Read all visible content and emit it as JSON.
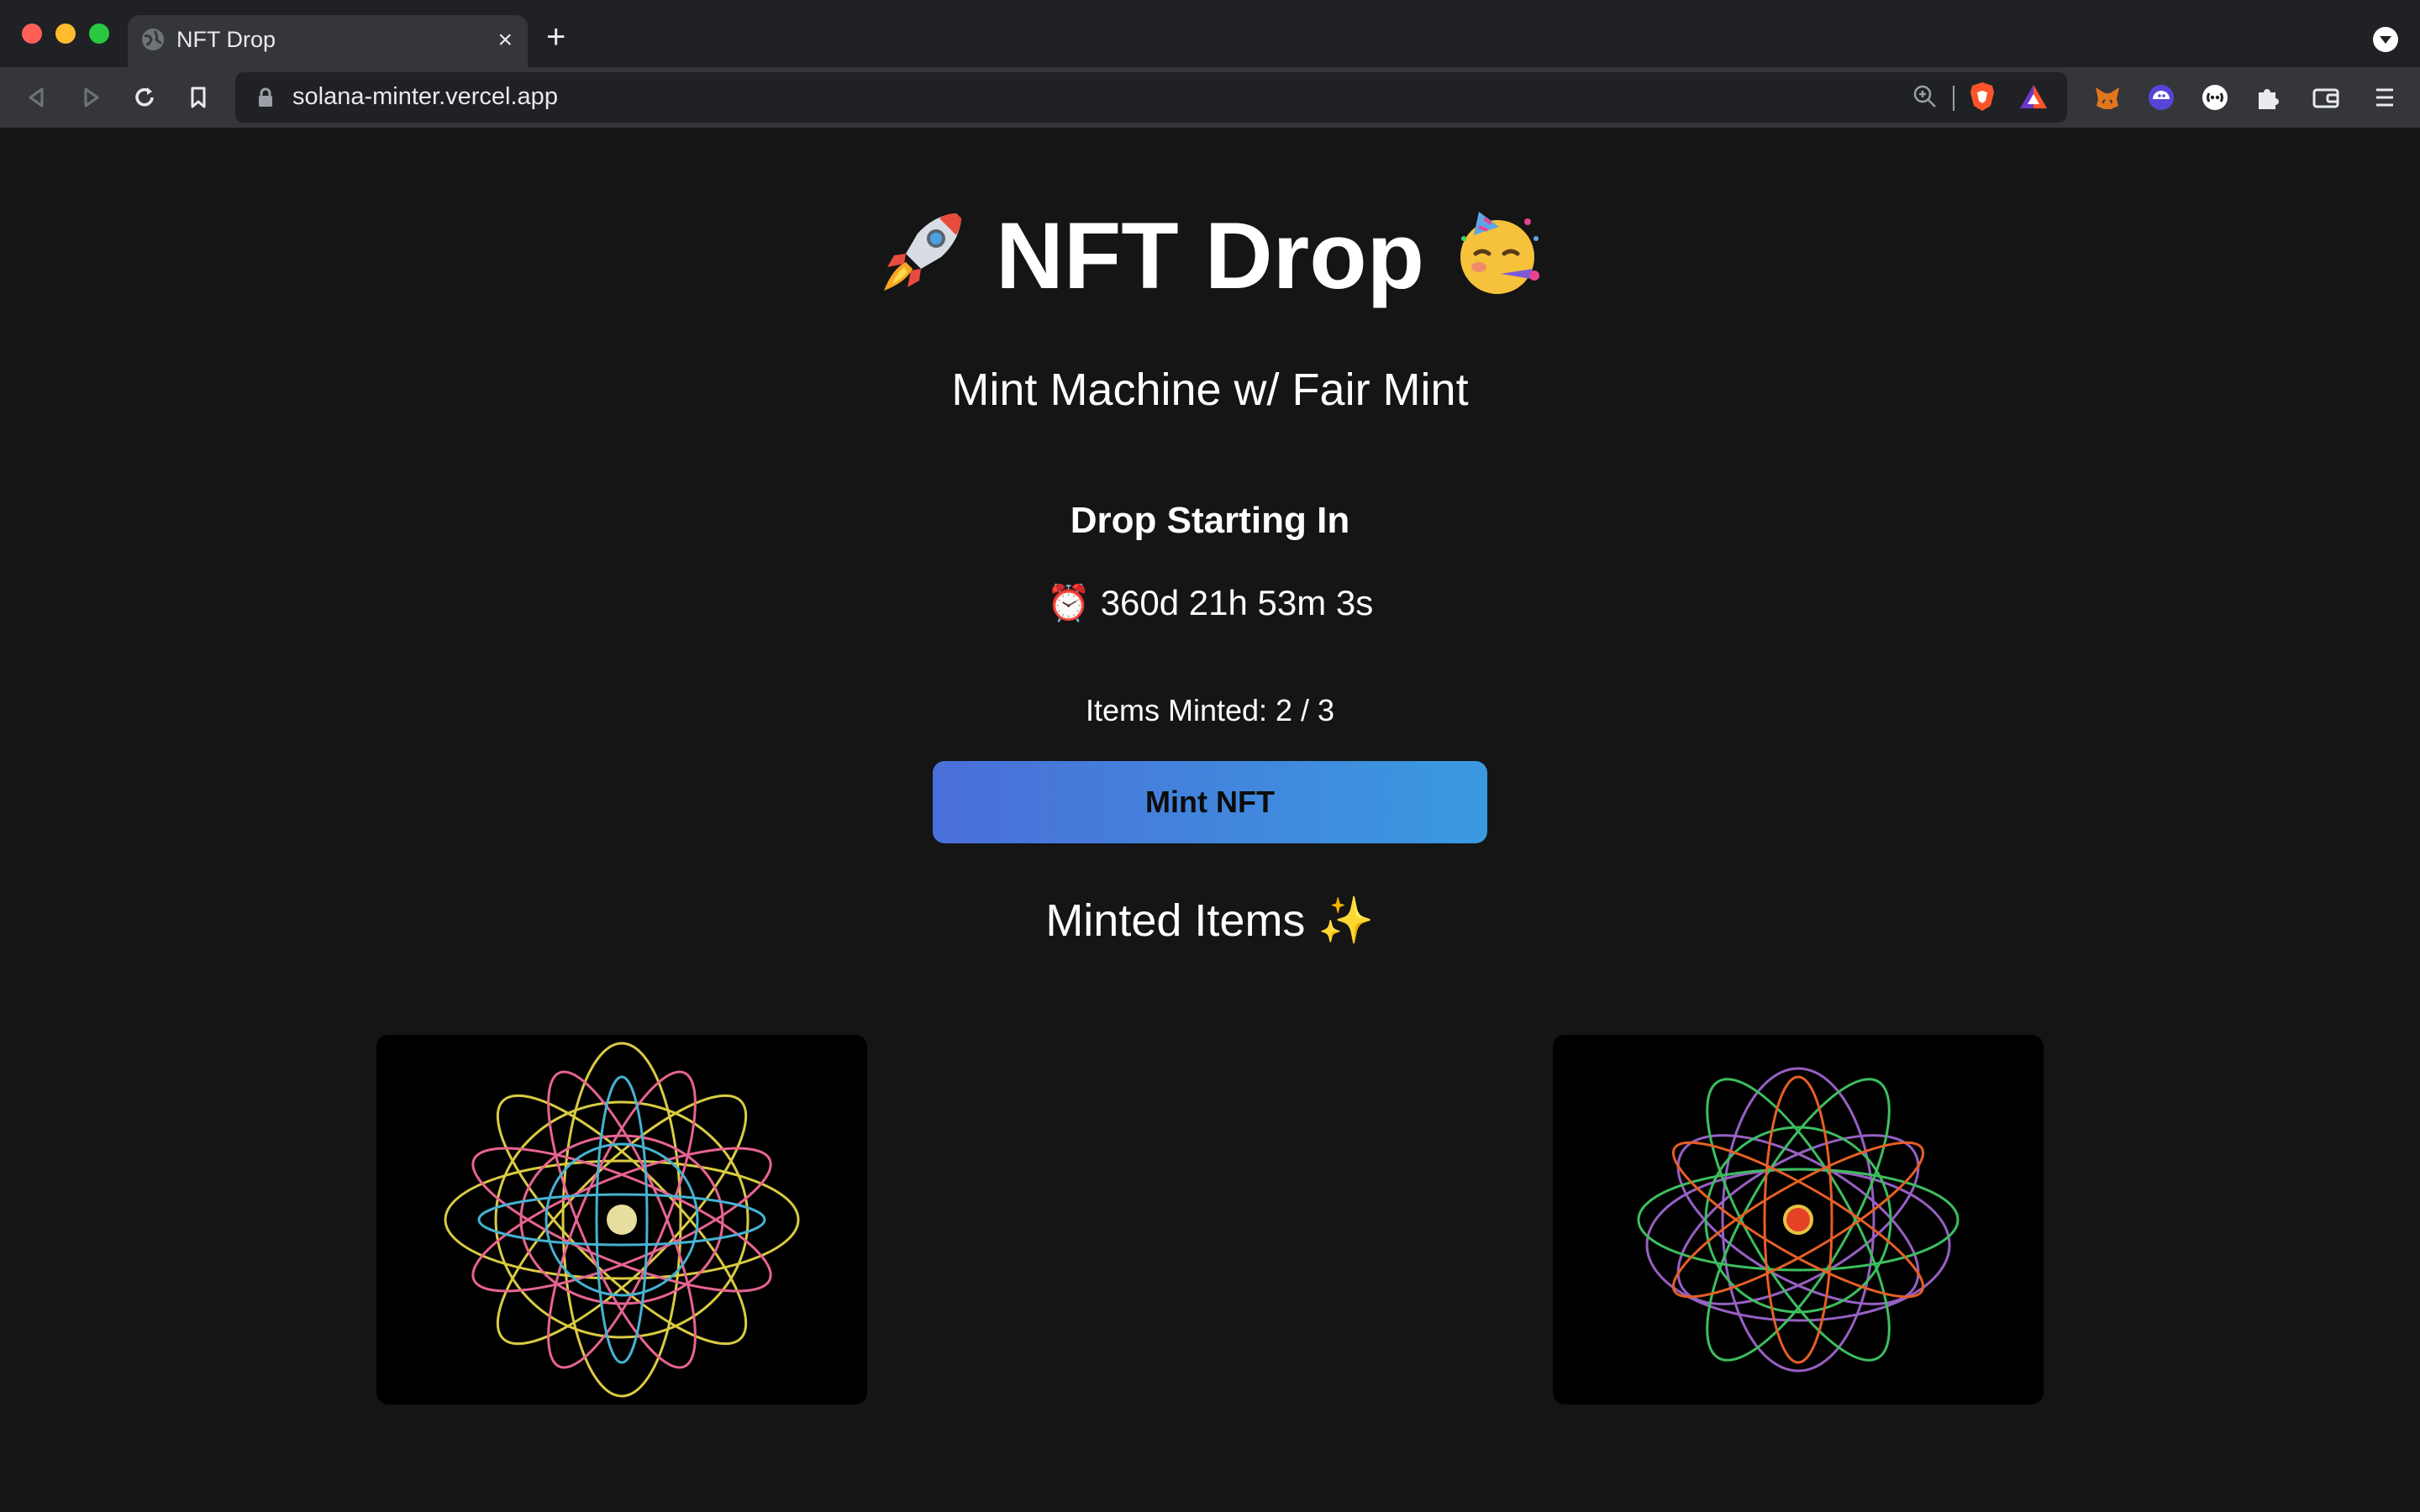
{
  "browser": {
    "tab_title": "NFT Drop",
    "url": "solana-minter.vercel.app"
  },
  "page": {
    "heading": "NFT Drop",
    "heading_emoji_left": "🚀",
    "heading_emoji_right": "🥳",
    "subtitle": "Mint Machine w/ Fair Mint",
    "drop_label": "Drop Starting In",
    "countdown_icon": "⏰",
    "countdown": "360d 21h 53m 3s",
    "items_minted": "Items Minted: 2 / 3",
    "mint_button": "Mint NFT",
    "minted_items_title": "Minted Items ✨",
    "accent_gradient": [
      "#4a6fd9",
      "#3a9ae0"
    ],
    "nft_items": [
      {
        "colors": [
          "#f2e14a",
          "#ff6fa0",
          "#4ec6e8"
        ]
      },
      {
        "colors": [
          "#44d36a",
          "#ff6a2a",
          "#a86bd9"
        ]
      }
    ]
  },
  "icons": {
    "tab": "globe-icon",
    "toolbar": [
      "back-icon",
      "forward-icon",
      "reload-icon",
      "bookmark-icon",
      "lock-icon",
      "zoom-icon",
      "brave-shield-icon",
      "brave-rewards-icon",
      "metamask-icon",
      "phantom-icon",
      "extension-icon",
      "puzzle-icon",
      "wallet-icon",
      "menu-icon"
    ]
  }
}
